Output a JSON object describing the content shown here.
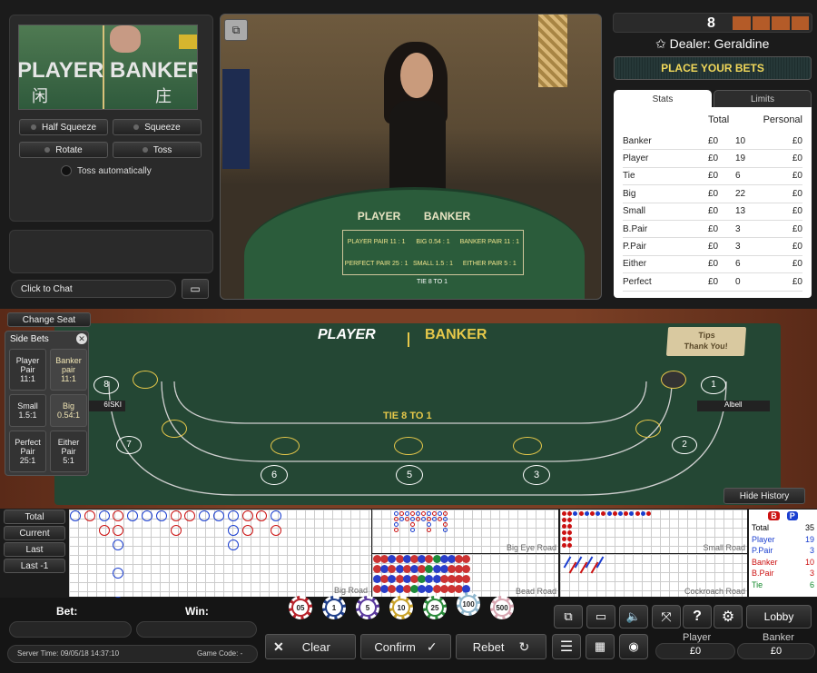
{
  "topleft": {
    "cam_player": "PLAYER",
    "cam_banker": "BANKER",
    "cam_player_cn": "闲",
    "cam_banker_cn": "庄",
    "buttons": [
      "Half Squeeze",
      "Squeeze",
      "Rotate",
      "Toss"
    ],
    "toss_auto": "Toss automatically",
    "chat": "Click to Chat"
  },
  "video": {
    "table_player": "PLAYER",
    "table_banker": "BANKER",
    "player_pair": "PLAYER PAIR 11 : 1",
    "big": "BIG 0.54 : 1",
    "banker_pair": "BANKER PAIR 11 : 1",
    "perfect_pair": "PERFECT PAIR 25 : 1",
    "small": "SMALL 1.5 : 1",
    "either_pair": "EITHER PAIR 5 : 1",
    "tie": "TIE 8 TO 1"
  },
  "right": {
    "round": "8",
    "dealer": "Dealer: Geraldine",
    "place_bets": "PLACE YOUR BETS",
    "tabs": [
      "Stats",
      "Limits"
    ],
    "col_total": "Total",
    "col_personal": "Personal",
    "rows": [
      {
        "name": "Banker",
        "amt": "£0",
        "n": "10",
        "p": "£0"
      },
      {
        "name": "Player",
        "amt": "£0",
        "n": "19",
        "p": "£0"
      },
      {
        "name": "Tie",
        "amt": "£0",
        "n": "6",
        "p": "£0"
      },
      {
        "name": "Big",
        "amt": "£0",
        "n": "22",
        "p": "£0"
      },
      {
        "name": "Small",
        "amt": "£0",
        "n": "13",
        "p": "£0"
      },
      {
        "name": "B.Pair",
        "amt": "£0",
        "n": "3",
        "p": "£0"
      },
      {
        "name": "P.Pair",
        "amt": "£0",
        "n": "3",
        "p": "£0"
      },
      {
        "name": "Either",
        "amt": "£0",
        "n": "6",
        "p": "£0"
      },
      {
        "name": "Perfect",
        "amt": "£0",
        "n": "0",
        "p": "£0"
      }
    ]
  },
  "table": {
    "change_seat": "Change Seat",
    "side_bets": "Side Bets",
    "side": [
      {
        "l": "Player Pair",
        "o": "11:1"
      },
      {
        "l": "Banker pair",
        "o": "11:1"
      },
      {
        "l": "Small",
        "o": "1.5:1"
      },
      {
        "l": "Big",
        "o": "0.54:1"
      },
      {
        "l": "Perfect Pair",
        "o": "25:1"
      },
      {
        "l": "Either Pair",
        "o": "5:1"
      }
    ],
    "player": "PLAYER",
    "banker": "BANKER",
    "tips1": "Tips",
    "tips2": "Thank You!",
    "tie": "TIE 8 TO 1",
    "seat_left": "6ISKI",
    "seat_right": "Albell",
    "seat_nums": [
      "6",
      "5",
      "3",
      "7",
      "2",
      "1",
      "8"
    ],
    "hide_history": "Hide History",
    "lbl_banker": "BANKER",
    "lbl_player": "PLAYER"
  },
  "history": {
    "tabs": [
      "Total",
      "Current",
      "Last",
      "Last -1"
    ],
    "big_eye": "Big Eye Road",
    "small": "Small Road",
    "bead": "Bead Road",
    "big": "Big Road",
    "cockroach": "Cockroach Road",
    "legend": [
      {
        "l": "Total",
        "v": "35",
        "c": "#000000"
      },
      {
        "l": "Player",
        "v": "19",
        "c": "#1a3ecf"
      },
      {
        "l": "P.Pair",
        "v": "3",
        "c": "#1a3ecf"
      },
      {
        "l": "Banker",
        "v": "10",
        "c": "#cc1111"
      },
      {
        "l": "B.Pair",
        "v": "3",
        "c": "#cc1111"
      },
      {
        "l": "Tie",
        "v": "6",
        "c": "#11882a"
      }
    ],
    "b": "B",
    "p": "P"
  },
  "bottom": {
    "bet": "Bet:",
    "win": "Win:",
    "server_time": "Server Time: 09/05/18 14:37:10",
    "game_code": "Game Code: -",
    "chips": [
      "05",
      "1",
      "5",
      "10",
      "25",
      "100",
      "500"
    ],
    "clear": "Clear",
    "confirm": "Confirm",
    "rebet": "Rebet",
    "lobby": "Lobby",
    "player": "Player",
    "banker": "Banker",
    "player_amt": "£0",
    "banker_amt": "£0"
  },
  "colors": {
    "felt": "#254a35",
    "banker_red": "#cc1111",
    "player_blue": "#1a3ecf",
    "gold": "#e6c84a"
  }
}
